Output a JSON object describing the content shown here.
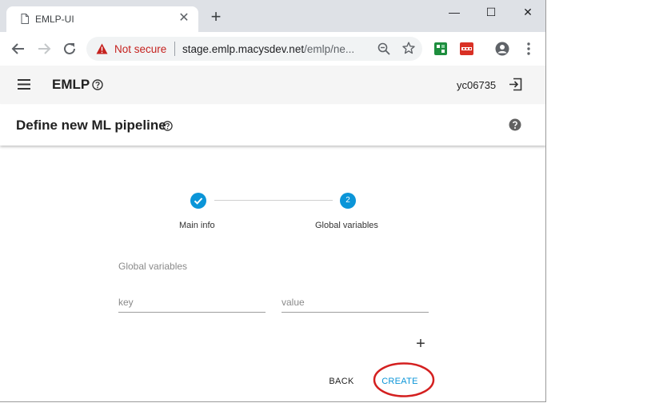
{
  "browser": {
    "tab_title": "EMLP-UI",
    "tab_close": "✕",
    "new_tab": "+",
    "window_controls": {
      "minimize": "—",
      "maximize": "☐",
      "close": "✕"
    },
    "security_label": "Not secure",
    "url_host": "stage.emlp.macysdev.net",
    "url_path": "/emlp/ne..."
  },
  "app": {
    "name": "EMLP",
    "username": "yc06735"
  },
  "page": {
    "title": "Define new ML pipeline"
  },
  "stepper": {
    "steps": [
      {
        "label": "Main info",
        "state": "completed",
        "marker": ""
      },
      {
        "label": "Global variables",
        "state": "active",
        "marker": "2"
      }
    ]
  },
  "form": {
    "section_label": "Global variables",
    "key_placeholder": "key",
    "value_placeholder": "value",
    "add_symbol": "+"
  },
  "actions": {
    "back_label": "BACK",
    "create_label": "CREATE"
  },
  "colors": {
    "accent": "#0b95d8",
    "annotation": "#d42020",
    "not_secure": "#c5221f"
  }
}
